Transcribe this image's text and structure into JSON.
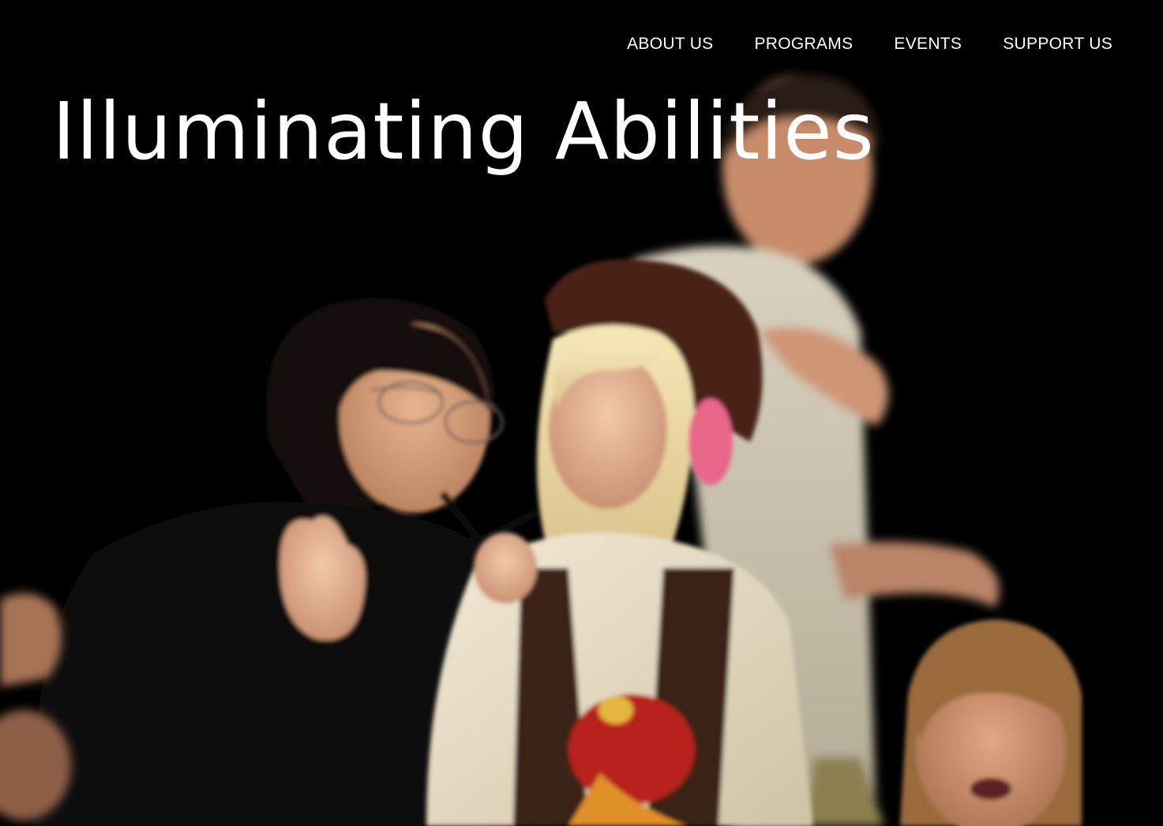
{
  "nav": {
    "items": [
      {
        "label": "ABOUT US"
      },
      {
        "label": "PROGRAMS"
      },
      {
        "label": "EVENTS"
      },
      {
        "label": "SUPPORT US"
      }
    ]
  },
  "hero": {
    "title": "Illuminating Abilities"
  },
  "colors": {
    "background": "#000000",
    "text": "#ffffff"
  }
}
